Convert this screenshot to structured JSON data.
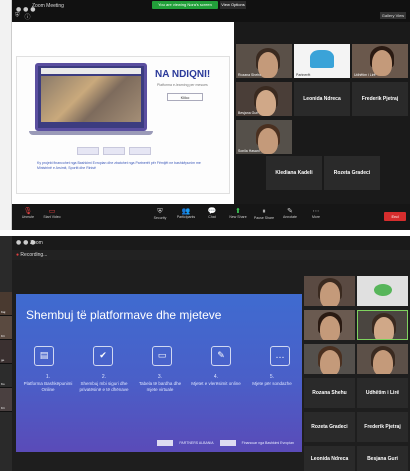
{
  "top": {
    "window_title": "Zoom Meeting",
    "share_banner": "You are viewing Nora's screen",
    "stop_label": "View Options",
    "gallery_view_label": "Gallery View",
    "webpage": {
      "title": "NA NDIQNI!",
      "subtitle": "Platforma e-learning per mesues",
      "input_value": "Kliko",
      "footer": "Ky projekt financohet nga Bashkimi Evropian dhe zbatohet nga Partnerët për Fëmijët ne bashkëpunim me Ministrinë e Arsimit, Sportit dhe Rinisë"
    },
    "participants": [
      {
        "name": "Rozana Shehu"
      },
      {
        "name": "Partnerët"
      },
      {
        "name": "Udhëtim i Lirë"
      },
      {
        "name": "Besjana Guri"
      },
      {
        "name": "Leonida Ndreca"
      },
      {
        "name": "Frederik Pjetraj"
      },
      {
        "name": "Sonila Hasani"
      },
      {
        "name": "Klediana Kadeli"
      },
      {
        "name": "Rozeta Gradeci"
      }
    ],
    "controls": [
      {
        "icon": "mic-icon",
        "label": "Unmute"
      },
      {
        "icon": "video-icon",
        "label": "Start Video"
      },
      {
        "icon": "security-icon",
        "label": "Security"
      },
      {
        "icon": "participants-icon",
        "label": "Participants"
      },
      {
        "icon": "chat-icon",
        "label": "Chat"
      },
      {
        "icon": "share-icon",
        "label": "New Share"
      },
      {
        "icon": "pause-icon",
        "label": "Pause Share"
      },
      {
        "icon": "annotate-icon",
        "label": "Annotate"
      },
      {
        "icon": "more-icon",
        "label": "More"
      }
    ],
    "end_label": "End"
  },
  "bottom": {
    "window_title": "Zoom",
    "rec_label": "Recording...",
    "slide": {
      "title": "Shembuj të platformave dhe mjeteve",
      "items": [
        {
          "num": "1.",
          "text": "Platforma Bashkëpunimi Online",
          "icon": "monitor-icon"
        },
        {
          "num": "2.",
          "text": "Shembuj mbi siguri dhe privatësinë e të dhënave",
          "icon": "shield-icon"
        },
        {
          "num": "3.",
          "text": "Tabela të bardha dhe mjete virtuale",
          "icon": "screen-icon"
        },
        {
          "num": "4.",
          "text": "Mjetet e vlerësimit online",
          "icon": "edit-icon"
        },
        {
          "num": "5.",
          "text": "Mjete për sondazhe",
          "icon": "chat-icon"
        }
      ],
      "footer_org": "PARTNERS ALBANIA",
      "footer_eu": "Financuar nga Bashkimi Evropian"
    },
    "participants": [
      {
        "name": ""
      },
      {
        "name": ""
      },
      {
        "name": ""
      },
      {
        "name": ""
      },
      {
        "name": ""
      },
      {
        "name": ""
      },
      {
        "name": "Rozana Shehu"
      },
      {
        "name": "Udhëtim i Lirë"
      },
      {
        "name": "Rozeta Gradeci"
      },
      {
        "name": "Frederik Pjetraj"
      },
      {
        "name": "Leonida Ndreca"
      },
      {
        "name": "Besjana Guri"
      }
    ]
  },
  "left_strip": {
    "labels": [
      "Kaj",
      "Kri",
      "ge",
      "Ko",
      "Kri"
    ]
  },
  "colors": {
    "green_banner": "#22a03a",
    "end_red": "#d62d2d",
    "slide_blue": "#3f6bd0",
    "slide_purple": "#5a4bb8"
  }
}
